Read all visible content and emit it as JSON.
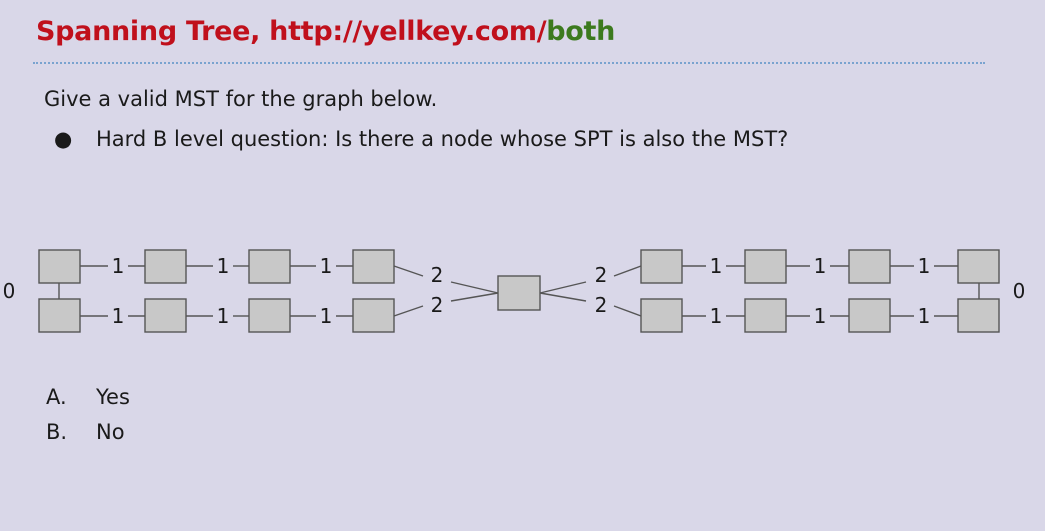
{
  "slide": {
    "title_red": "Spanning Tree, http://yellkey.com/",
    "title_green": "both",
    "intro": "Give a valid MST for the graph below.",
    "bullets": [
      {
        "symbol": "●",
        "text": "Hard B level question: Is there a node whose SPT is also the MST?"
      }
    ],
    "answers": [
      {
        "letter": "A.",
        "text": "Yes"
      },
      {
        "letter": "B.",
        "text": "No"
      }
    ]
  },
  "graph": {
    "left_vertical_weight": "0",
    "right_vertical_weight": "0",
    "left_top_weights": [
      "1",
      "1",
      "1"
    ],
    "left_bottom_weights": [
      "1",
      "1",
      "1"
    ],
    "center_left_top_weight": "2",
    "center_left_bottom_weight": "2",
    "center_right_top_weight": "2",
    "center_right_bottom_weight": "2",
    "right_top_weights": [
      "1",
      "1",
      "1"
    ],
    "right_bottom_weights": [
      "1",
      "1",
      "1"
    ]
  },
  "colors": {
    "background": "#d9d7e8",
    "title_red": "#c0101c",
    "title_green": "#3c7a1e",
    "node_fill": "#c8c8c8",
    "edge": "#555555"
  }
}
